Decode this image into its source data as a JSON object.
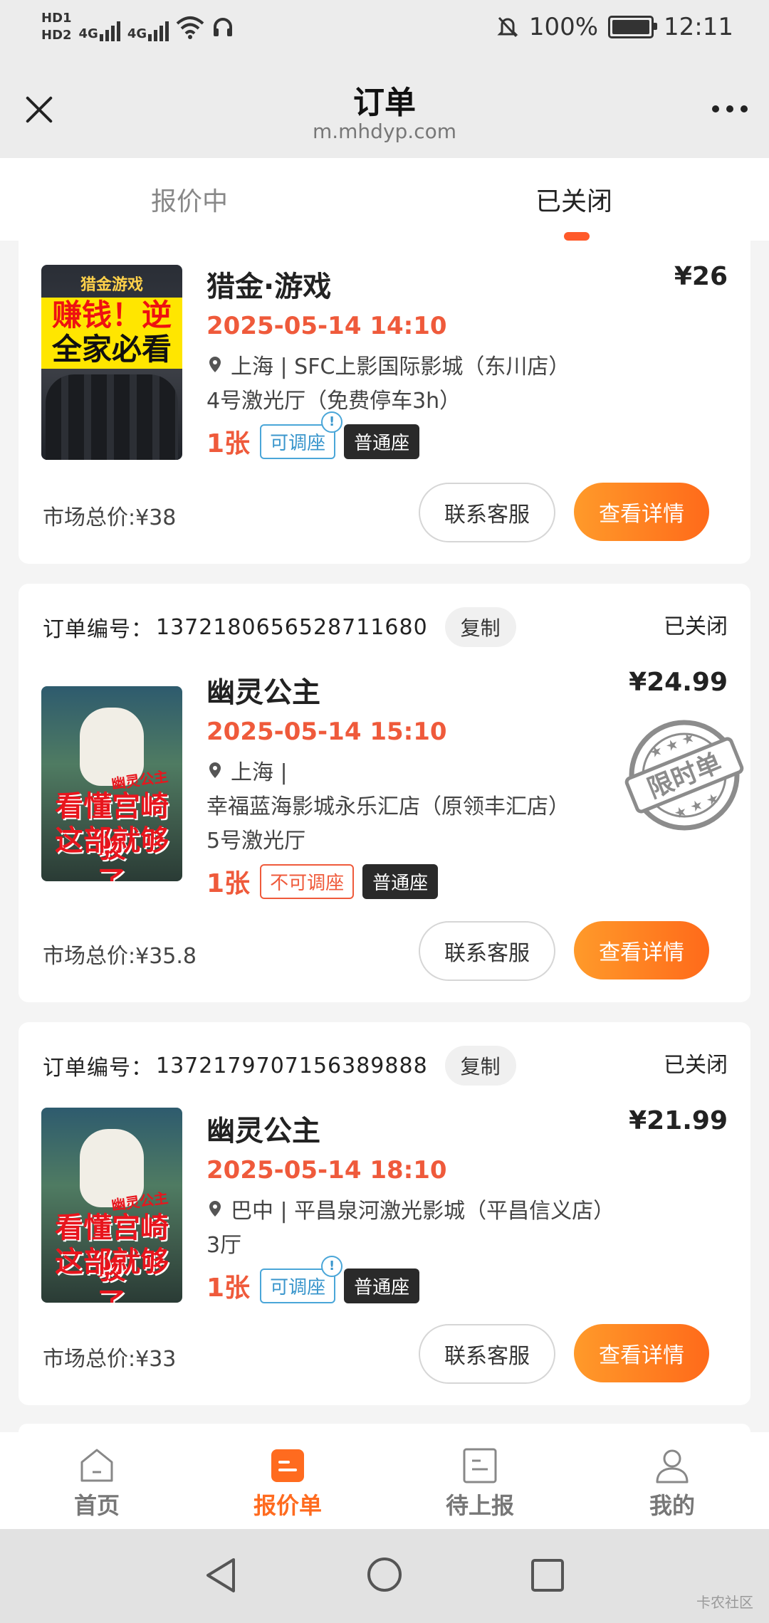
{
  "status_bar": {
    "hd1": "HD1",
    "hd2": "HD2",
    "sim1": "4G",
    "sim2": "4G",
    "battery": "100%",
    "time": "12:11"
  },
  "header": {
    "title": "订单",
    "url": "m.mhdyp.com"
  },
  "tabs": [
    {
      "label": "报价中"
    },
    {
      "label": "已关闭",
      "active": true
    }
  ],
  "common": {
    "order_label": "订单编号：",
    "copy": "复制",
    "contact": "联系客服",
    "details": "查看详情",
    "market_label": "市场总价:"
  },
  "orders": [
    {
      "title": "猎金·游戏",
      "price": "¥26",
      "show_time": "2025-05-14 14:10",
      "address": "上海 | SFC上影国际影城（东川店）",
      "hall": "4号激光厅（免费停车3h）",
      "qty": "1张",
      "adjust_tag": "可调座",
      "seat_type": "普通座",
      "market_price": "¥38",
      "poster": {
        "top": "猎金游戏",
        "line1": "赚钱！逆袭！",
        "line2": "全家必看"
      }
    },
    {
      "order_no": "1372180656528711680",
      "status": "已关闭",
      "title": "幽灵公主",
      "price": "¥24.99",
      "show_time": "2025-05-14 15:10",
      "address": "上海 |",
      "cinema": "幸福蓝海影城永乐汇店（原领丰汇店）",
      "hall": "5号激光厅",
      "qty": "1张",
      "adjust_tag": "不可调座",
      "seat_type": "普通座",
      "market_price": "¥35.8",
      "stamp": "限时单",
      "poster": {
        "small": "幽灵公主",
        "line1": "看懂宫崎骏",
        "line2": "这部就够了"
      }
    },
    {
      "order_no": "1372179707156389888",
      "status": "已关闭",
      "title": "幽灵公主",
      "price": "¥21.99",
      "show_time": "2025-05-14 18:10",
      "address": "巴中 | 平昌泉河激光影城（平昌信义店）",
      "hall": "3厅",
      "qty": "1张",
      "adjust_tag": "可调座",
      "seat_type": "普通座",
      "market_price": "¥33",
      "poster": {
        "small": "幽灵公主",
        "line1": "看懂宫崎骏",
        "line2": "这部就够了"
      }
    }
  ],
  "bottom_nav": [
    {
      "label": "首页",
      "icon": "home-icon"
    },
    {
      "label": "报价单",
      "icon": "quote-list-icon",
      "active": true
    },
    {
      "label": "待上报",
      "icon": "pending-report-icon"
    },
    {
      "label": "我的",
      "icon": "profile-icon"
    }
  ],
  "system_nav": {
    "icons": [
      "back-icon",
      "home-circle-icon",
      "recents-icon"
    ]
  },
  "watermark": "卡农社区",
  "colors": {
    "accent": "#ff6b1f",
    "date": "#ef5a3b",
    "tag_blue": "#3a96cc"
  }
}
